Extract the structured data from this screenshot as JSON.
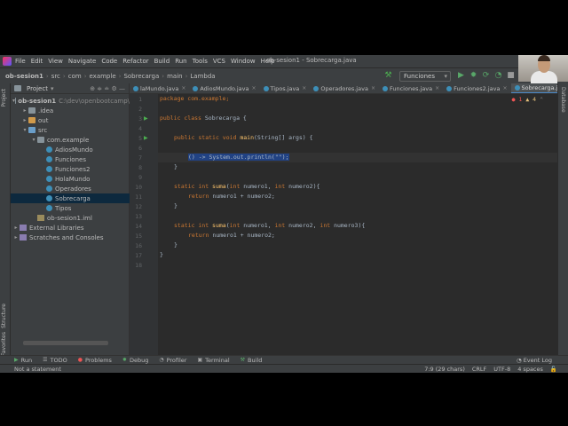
{
  "menu": [
    "File",
    "Edit",
    "View",
    "Navigate",
    "Code",
    "Refactor",
    "Build",
    "Run",
    "Tools",
    "VCS",
    "Window",
    "Help"
  ],
  "window_title": "ob-sesion1 - Sobrecarga.java",
  "breadcrumbs": [
    "ob-sesion1",
    "src",
    "com",
    "example",
    "Sobrecarga",
    "main",
    "Lambda"
  ],
  "run_config": "Funciones",
  "project_panel": {
    "title": "Project",
    "tree": [
      {
        "label": "ob-sesion1",
        "path": "C:\\dev\\openbootcamp\\",
        "depth": 0,
        "arrow": "▾",
        "icon": "folder"
      },
      {
        "label": ".idea",
        "depth": 1,
        "arrow": "▸",
        "icon": "folder"
      },
      {
        "label": "out",
        "depth": 1,
        "arrow": "▸",
        "icon": "folder-orange"
      },
      {
        "label": "src",
        "depth": 1,
        "arrow": "▾",
        "icon": "folder-blue"
      },
      {
        "label": "com.example",
        "depth": 2,
        "arrow": "▾",
        "icon": "folder"
      },
      {
        "label": "AdiosMundo",
        "depth": 3,
        "icon": "class"
      },
      {
        "label": "Funciones",
        "depth": 3,
        "icon": "class"
      },
      {
        "label": "Funciones2",
        "depth": 3,
        "icon": "class"
      },
      {
        "label": "HolaMundo",
        "depth": 3,
        "icon": "class"
      },
      {
        "label": "Operadores",
        "depth": 3,
        "icon": "class"
      },
      {
        "label": "Sobrecarga",
        "depth": 3,
        "icon": "class",
        "selected": true
      },
      {
        "label": "Tipos",
        "depth": 3,
        "icon": "class"
      },
      {
        "label": "ob-sesion1.iml",
        "depth": 2,
        "icon": "xml"
      },
      {
        "label": "External Libraries",
        "depth": 0,
        "arrow": "▸",
        "icon": "lib"
      },
      {
        "label": "Scratches and Consoles",
        "depth": 0,
        "arrow": "▸",
        "icon": "lib"
      }
    ]
  },
  "tabs": [
    {
      "label": "laMundo.java",
      "active": false
    },
    {
      "label": "AdiosMundo.java",
      "active": false
    },
    {
      "label": "Tipos.java",
      "active": false
    },
    {
      "label": "Operadores.java",
      "active": false
    },
    {
      "label": "Funciones.java",
      "active": false
    },
    {
      "label": "Funciones2.java",
      "active": false
    },
    {
      "label": "Sobrecarga.java",
      "active": true
    }
  ],
  "inspections": {
    "errors": "1",
    "warnings": "4"
  },
  "line_numbers": [
    "1",
    "2",
    "3",
    "4",
    "5",
    "6",
    "7",
    "8",
    "9",
    "10",
    "11",
    "12",
    "13",
    "14",
    "15",
    "16",
    "17",
    "18"
  ],
  "code": {
    "l1": "package com.example;",
    "l3_kw": "public class ",
    "l3_name": "Sobrecarga",
    "l3_end": " {",
    "l5_kw": "public static void ",
    "l5_fn": "main",
    "l5_rest": "(String[] args) {",
    "l7": "() -> System.out.println(\"\");",
    "l8": "}",
    "l10_kw": "static int ",
    "l10_fn": "suma",
    "l10_kw2": "int ",
    "l10_a": "numero1, ",
    "l10_b": "numero2",
    "l10_end": "){",
    "l11_kw": "return ",
    "l11_rest": "numero1 + numero2;",
    "l12": "}",
    "l14_kw": "static int ",
    "l14_fn": "suma",
    "l14_kw2": "int ",
    "l14_a": "numero1, ",
    "l14_b": "numero2, ",
    "l14_c": "numero3",
    "l14_end": "){",
    "l15_kw": "return ",
    "l15_rest": "numero1 + numero2;",
    "l16": "}",
    "l17": "}"
  },
  "bottom_tools": [
    "Run",
    "TODO",
    "Problems",
    "Debug",
    "Profiler",
    "Terminal",
    "Build"
  ],
  "event_log": "Event Log",
  "status": {
    "message": "Not a statement",
    "position": "7:9 (29 chars)",
    "line_sep": "CRLF",
    "encoding": "UTF-8",
    "indent": "4 spaces"
  },
  "side_labels": {
    "project": "Project",
    "structure": "Structure",
    "favorites": "Favorites",
    "database": "Database"
  }
}
